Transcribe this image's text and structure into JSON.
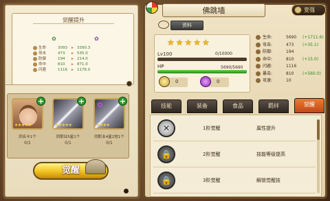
{
  "left": {
    "title": "觉醒提升",
    "stats": [
      {
        "label": "生命",
        "before": "3093",
        "after": "3390.3"
      },
      {
        "label": "攻击",
        "before": "473",
        "after": "535.0"
      },
      {
        "label": "防御",
        "before": "194",
        "after": "214.0"
      },
      {
        "label": "命中",
        "before": "810",
        "after": "871.0"
      },
      {
        "label": "闪避",
        "before": "1116",
        "after": "1176.0"
      }
    ],
    "materials": [
      {
        "label": "同名卡1个",
        "count": "0/1"
      },
      {
        "label": "同职业5星1个",
        "count": "0/1"
      },
      {
        "label": "同职业4星2觉1个",
        "count": "0/1"
      }
    ],
    "awaken_button": "觉醒"
  },
  "right": {
    "hero_name": "佛跳墙",
    "strong_button": "变强",
    "info_tab": "资料",
    "level_label": "Lv100",
    "level_value": "0/10000",
    "hp_label": "HP",
    "hp_value": "5690/5690",
    "hp_fill": 1.0,
    "resource1": "0",
    "resource2": "0",
    "attributes": [
      {
        "label": "生命:",
        "value": "5690",
        "bonus": "(+1711.6)"
      },
      {
        "label": "攻击:",
        "value": "473",
        "bonus": "(+35.1)"
      },
      {
        "label": "防御:",
        "value": "194",
        "bonus": ""
      },
      {
        "label": "命中:",
        "value": "810",
        "bonus": "(+15.0)"
      },
      {
        "label": "闪避:",
        "value": "1116",
        "bonus": ""
      },
      {
        "label": "暴击:",
        "value": "810",
        "bonus": "(+560.0)"
      },
      {
        "label": "攻速:",
        "value": "10",
        "bonus": ""
      }
    ],
    "tabs": [
      "技能",
      "装备",
      "食品",
      "羁绊",
      "觉醒"
    ],
    "awaken_rows": [
      {
        "level": "1阶觉醒",
        "desc": "属性提升"
      },
      {
        "level": "2阶觉醒",
        "desc": "技能等级提高"
      },
      {
        "level": "3阶觉醒",
        "desc": "解锁觉醒技"
      }
    ]
  }
}
